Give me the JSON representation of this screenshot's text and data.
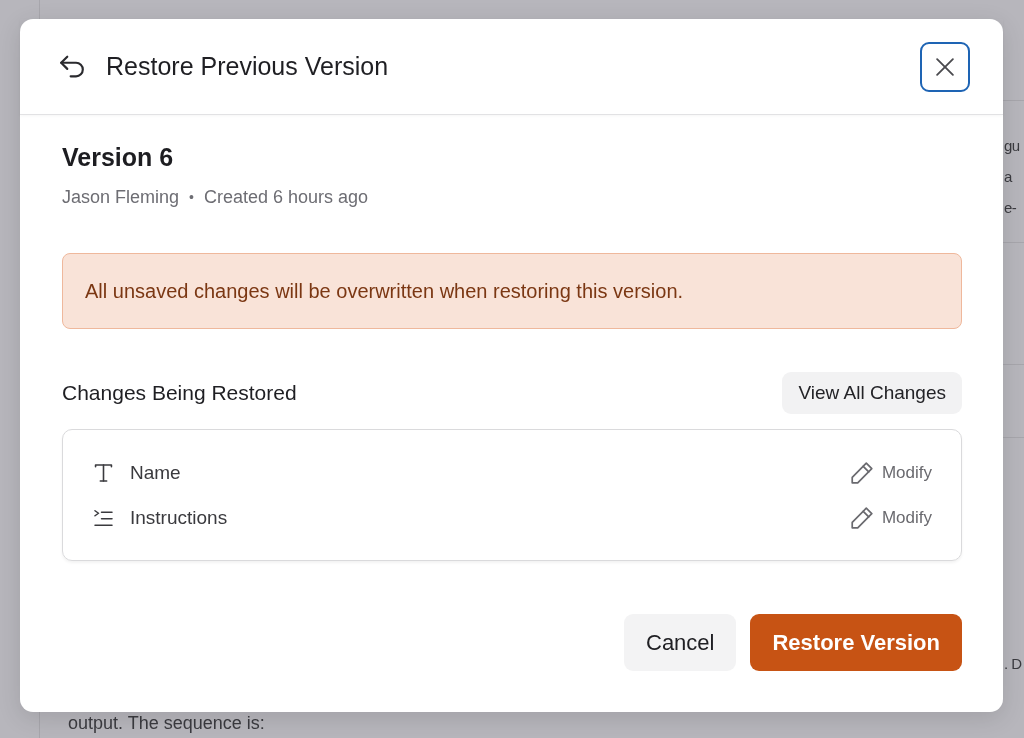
{
  "background": {
    "side_lines": [
      "gu",
      "a",
      "e-"
    ],
    "side_note": ". D",
    "footer_line": "output. The sequence is:"
  },
  "dialog": {
    "title": "Restore Previous Version",
    "close": {
      "focused": true
    }
  },
  "version": {
    "name": "Version 6",
    "author": "Jason Fleming",
    "separator": "•",
    "created": "Created 6 hours ago"
  },
  "warning": {
    "text": "All unsaved changes will be overwritten when restoring this version."
  },
  "changes": {
    "title": "Changes Being Restored",
    "view_all": "View All Changes",
    "items": [
      {
        "kind": "text",
        "label": "Name",
        "action": "Modify"
      },
      {
        "kind": "list",
        "label": "Instructions",
        "action": "Modify"
      }
    ]
  },
  "actions": [
    {
      "kind": "secondary",
      "label": "Cancel"
    },
    {
      "kind": "primary",
      "label": "Restore Version"
    }
  ]
}
